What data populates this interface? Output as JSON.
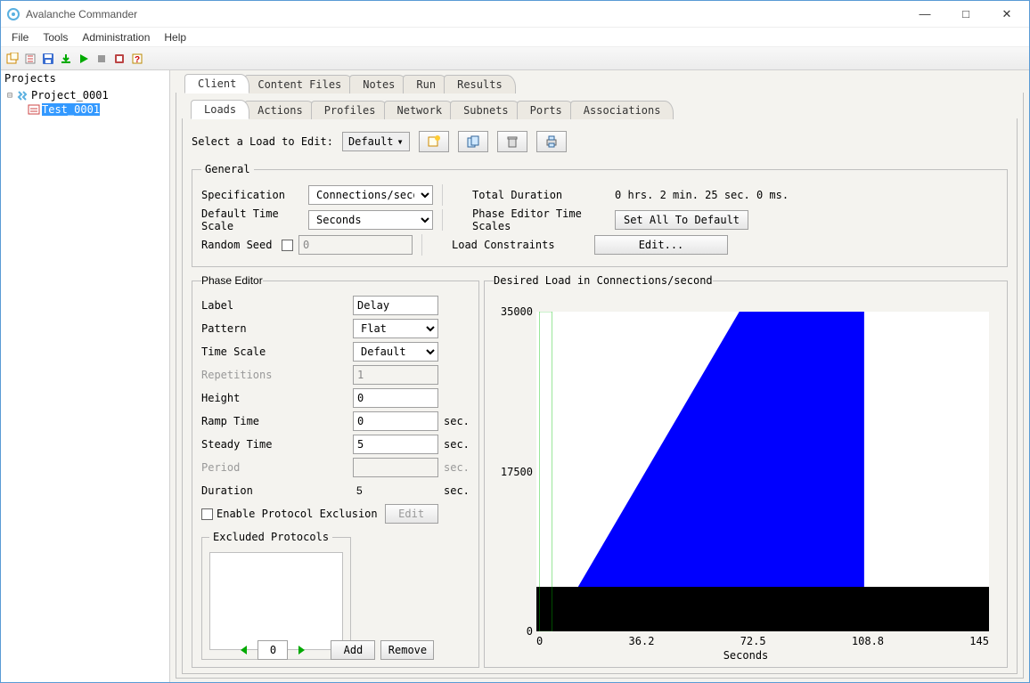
{
  "window": {
    "title": "Avalanche Commander"
  },
  "menu": {
    "file": "File",
    "tools": "Tools",
    "administration": "Administration",
    "help": "Help"
  },
  "sidebar": {
    "title": "Projects",
    "project": "Project_0001",
    "test": "Test_0001"
  },
  "tabs_top": {
    "client": "Client",
    "content_files": "Content Files",
    "notes": "Notes",
    "run": "Run",
    "results": "Results"
  },
  "tabs_sub": {
    "loads": "Loads",
    "actions": "Actions",
    "profiles": "Profiles",
    "network": "Network",
    "subnets": "Subnets",
    "ports": "Ports",
    "associations": "Associations"
  },
  "load_toolbar": {
    "select_label": "Select a Load to Edit:",
    "default": "Default"
  },
  "general": {
    "legend": "General",
    "specification_label": "Specification",
    "specification_value": "Connections/second",
    "default_time_scale_label": "Default Time Scale",
    "default_time_scale_value": "Seconds",
    "random_seed_label": "Random Seed",
    "random_seed_value": "0",
    "total_duration_label": "Total Duration",
    "total_duration_value": "0 hrs. 2 min. 25 sec. 0 ms.",
    "phase_editor_time_scales_label": "Phase Editor Time Scales",
    "set_all_default_btn": "Set All To Default",
    "load_constraints_label": "Load Constraints",
    "edit_btn": "Edit..."
  },
  "phase_editor": {
    "legend": "Phase Editor",
    "label_label": "Label",
    "label_value": "Delay",
    "pattern_label": "Pattern",
    "pattern_value": "Flat",
    "time_scale_label": "Time Scale",
    "time_scale_value": "Default",
    "repetitions_label": "Repetitions",
    "repetitions_value": "1",
    "height_label": "Height",
    "height_value": "0",
    "ramp_time_label": "Ramp Time",
    "ramp_time_value": "0",
    "steady_time_label": "Steady Time",
    "steady_time_value": "5",
    "period_label": "Period",
    "period_value": "",
    "duration_label": "Duration",
    "duration_value": "5",
    "sec": "sec.",
    "enable_excl_label": "Enable Protocol Exclusion",
    "edit_btn": "Edit",
    "excluded_legend": "Excluded Protocols",
    "nav_value": "0",
    "add_btn": "Add",
    "remove_btn": "Remove"
  },
  "chart": {
    "legend": "Desired Load in Connections/second",
    "y_max": "35000",
    "y_mid": "17500",
    "y_min": "0",
    "x0": "0",
    "x1": "36.2",
    "x2": "72.5",
    "x3": "108.8",
    "x4": "145",
    "xaxis_title": "Seconds"
  },
  "chart_data": {
    "type": "area",
    "title": "Desired Load in Connections/second",
    "xlabel": "Seconds",
    "ylabel": "",
    "xlim": [
      0,
      145
    ],
    "ylim": [
      0,
      35000
    ],
    "x_ticks": [
      0,
      36.2,
      72.5,
      108.8,
      145
    ],
    "y_ticks": [
      0,
      17500,
      35000
    ],
    "series": [
      {
        "name": "Desired Load",
        "x": [
          0,
          5,
          65,
          105,
          105
        ],
        "y": [
          0,
          0,
          35000,
          35000,
          0
        ],
        "fill": true,
        "color": "#0000ff"
      }
    ],
    "annotations": [
      {
        "type": "selection_rect",
        "x": [
          1,
          5
        ],
        "y": [
          0,
          35000
        ],
        "color": "#00c000"
      }
    ]
  }
}
